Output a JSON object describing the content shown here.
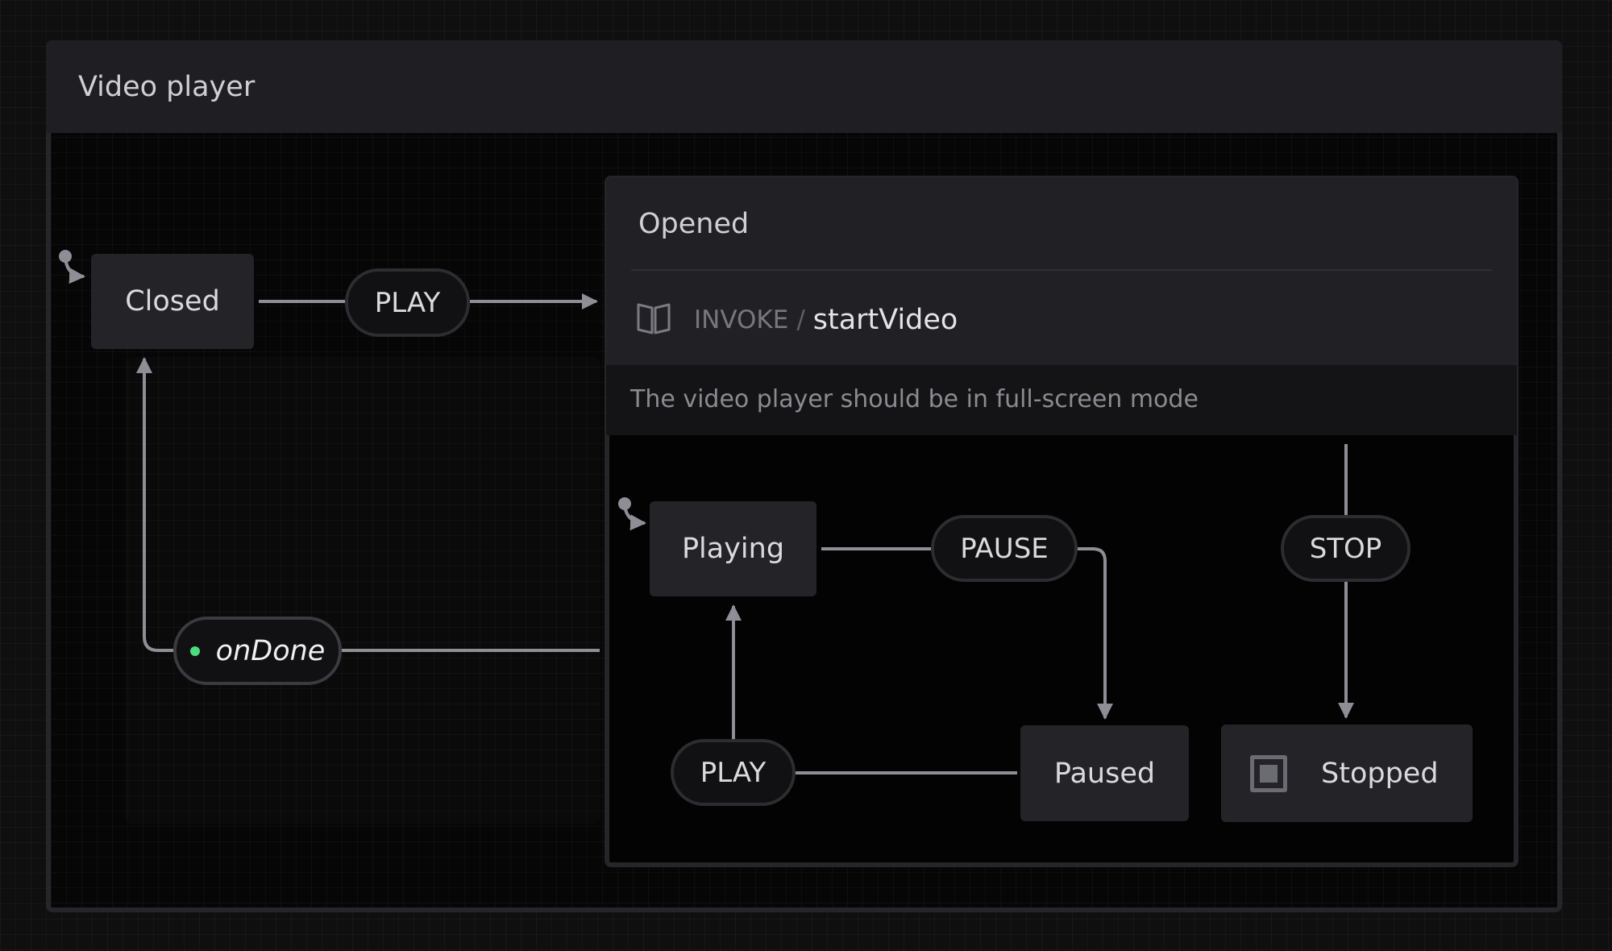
{
  "machine": {
    "title": "Video player"
  },
  "states": {
    "closed": "Closed",
    "opened": {
      "title": "Opened",
      "invoke_keyword": "INVOKE",
      "invoke_separator": "/",
      "invoke_source": "startVideo",
      "description": "The video player should be in full-screen mode",
      "invoke_icon": "book-icon"
    },
    "playing": "Playing",
    "paused": "Paused",
    "stopped": {
      "label": "Stopped",
      "icon": "final-state-icon"
    }
  },
  "events": {
    "play_top": "PLAY",
    "pause": "PAUSE",
    "stop": "STOP",
    "play_bottom": "PLAY",
    "on_done": "onDone"
  },
  "colors": {
    "background": "#0f0f10",
    "node": "#242428",
    "edge": "#8e8e96",
    "done_dot": "#4ade80"
  }
}
